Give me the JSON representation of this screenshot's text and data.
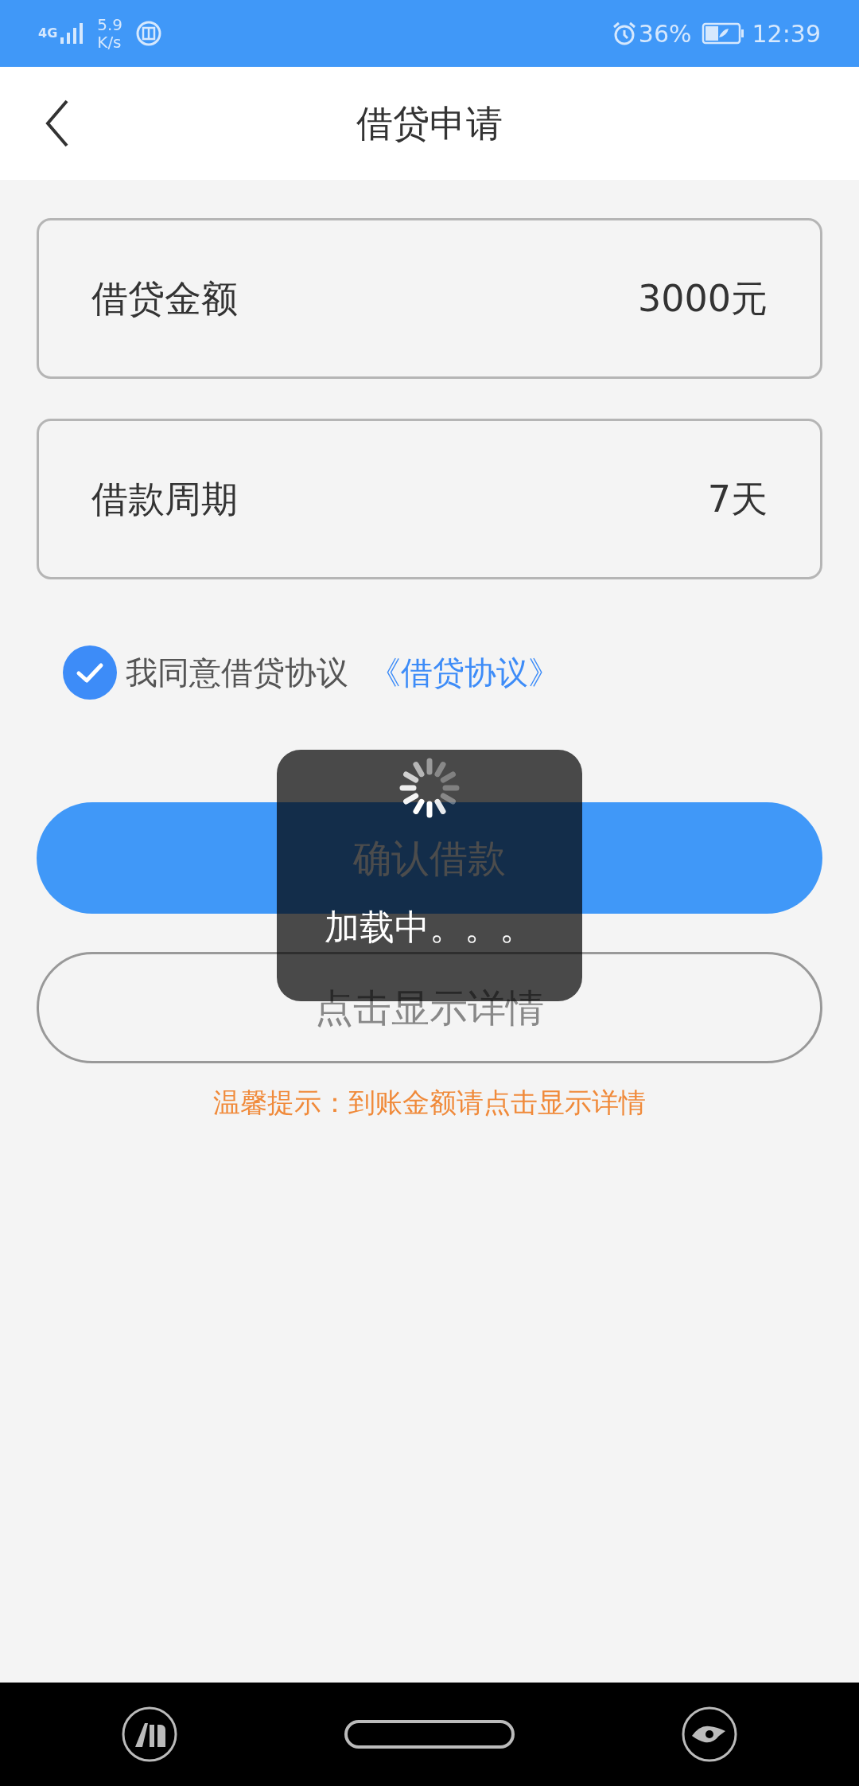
{
  "status_bar": {
    "network": "4G",
    "speed_value": "5.9",
    "speed_unit": "K/s",
    "battery": "36%",
    "time": "12:39"
  },
  "header": {
    "title": "借贷申请"
  },
  "fields": [
    {
      "label": "借贷金额",
      "value": "3000元"
    },
    {
      "label": "借款周期",
      "value": "7天"
    }
  ],
  "agreement": {
    "checked": true,
    "text": "我同意借贷协议",
    "link": "《借贷协议》"
  },
  "buttons": [
    {
      "kind": "primary",
      "label": "确认借款"
    },
    {
      "kind": "outline",
      "label": "点击显示详情"
    }
  ],
  "hint": "温馨提示：到账金额请点击显示详情",
  "loading": {
    "text": "加载中。。。"
  }
}
